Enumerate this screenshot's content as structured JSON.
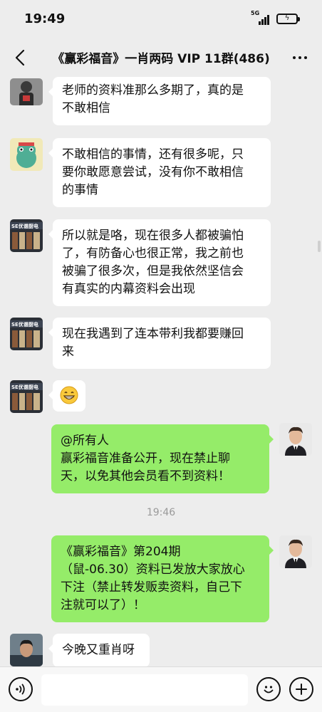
{
  "status_bar": {
    "time": "19:49",
    "network": "5G"
  },
  "header": {
    "title": "《赢彩福音》一肖两码 VIP 11群(486)"
  },
  "messages": [
    {
      "text": "老师的资料准那么多期了，真的是\n不敢相信"
    },
    {
      "text": "不敢相信的事情，还有很多呢，只\n要你敢愿意尝试，没有你不敢相信\n的事情"
    },
    {
      "text": "所以就是咯，现在很多人都被骗怕\n了，有防备心也很正常，我之前也\n被骗了很多次，但是我依然坚信会\n有真实的内幕资料会出现"
    },
    {
      "text": "现在我遇到了连本带利我都要赚回\n来"
    },
    {
      "text": "😁"
    },
    {
      "text": "@所有人\n赢彩福音准备公开，现在禁止聊\n天，以免其他会员看不到资料！"
    },
    {
      "text": "《赢彩福音》第204期\n（鼠-06.30）资料已发放大家放心\n下注（禁止转发贩卖资料，自己下\n注就可以了）！"
    },
    {
      "text": "今晚又重肖呀"
    }
  ],
  "timestamp": "19:46",
  "avatar_labels": {
    "shop": "SE优谱厨电"
  },
  "input": {
    "value": ""
  },
  "colors": {
    "background": "#ededed",
    "out_bubble": "#95ec69",
    "in_bubble": "#ffffff"
  }
}
